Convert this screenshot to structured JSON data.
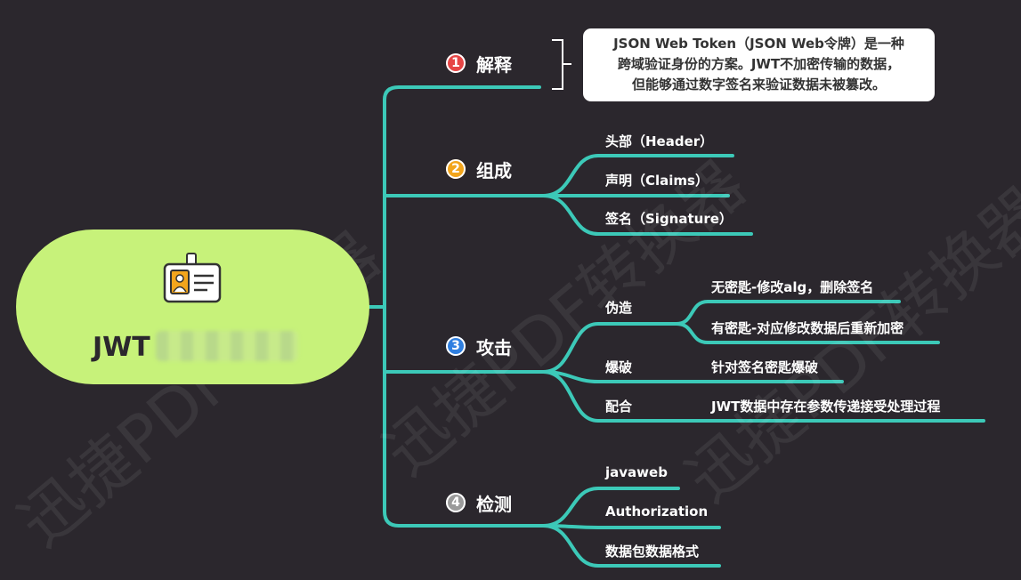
{
  "colors": {
    "background": "#2b272d",
    "line": "#3cc9b8",
    "central_fill": "#c7f27a",
    "badge1": "#e64545",
    "badge2": "#f2a51c",
    "badge3": "#2f7fe0",
    "badge4": "#9a9a9a"
  },
  "central": {
    "title": "JWT",
    "icon": "id-badge-icon"
  },
  "branches": {
    "explain": {
      "number": "1",
      "title": "解释",
      "callout": {
        "line1": "JSON Web Token（JSON Web令牌）是一种",
        "line2": "跨域验证身份的方案。JWT不加密传输的数据，",
        "line3": "但能够通过数字签名来验证数据未被篡改。"
      }
    },
    "compose": {
      "number": "2",
      "title": "组成",
      "items": [
        "头部（Header）",
        "声明（Claims）",
        "签名（Signature）"
      ]
    },
    "attack": {
      "number": "3",
      "title": "攻击",
      "forge": {
        "label": "伪造",
        "items": [
          "无密匙-修改alg，删除签名",
          "有密匙-对应修改数据后重新加密"
        ]
      },
      "crack": {
        "label": "爆破",
        "items": [
          "针对签名密匙爆破"
        ]
      },
      "combine": {
        "label": "配合",
        "items": [
          "JWT数据中存在参数传递接受处理过程"
        ]
      }
    },
    "detect": {
      "number": "4",
      "title": "检测",
      "items": [
        "javaweb",
        "Authorization",
        "数据包数据格式"
      ]
    }
  },
  "watermark": "迅捷PDF转换器"
}
